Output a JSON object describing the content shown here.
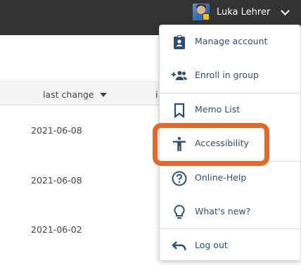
{
  "header": {
    "user_name": "Luka Lehrer",
    "avatar_icon": "user-avatar-icon",
    "menu_toggle_icon": "chevron-down-icon"
  },
  "table": {
    "columns": [
      {
        "label": "last change",
        "sort_icon": "sort-descending-icon"
      },
      {
        "label": "i"
      }
    ],
    "rows": [
      {
        "date": "2021-06-08"
      },
      {
        "date": "2021-06-08"
      },
      {
        "date": "2021-06-02"
      }
    ]
  },
  "user_menu": {
    "items": [
      {
        "label": "Manage account",
        "icon": "account-badge-icon"
      },
      {
        "label": "Enroll in group",
        "icon": "group-add-icon"
      },
      {
        "label": "Memo List",
        "icon": "bookmark-icon"
      },
      {
        "label": "Accessibility",
        "icon": "accessibility-icon"
      },
      {
        "label": "Online-Help",
        "icon": "help-circle-icon"
      },
      {
        "label": "What's new?",
        "icon": "lightbulb-icon"
      },
      {
        "label": "Log out",
        "icon": "undo-arrow-icon"
      }
    ]
  },
  "highlight_color": "#e4682a",
  "colors": {
    "topbar": "#333333",
    "menu_text": "#2f4f6e",
    "icon": "#2f4f6e"
  }
}
